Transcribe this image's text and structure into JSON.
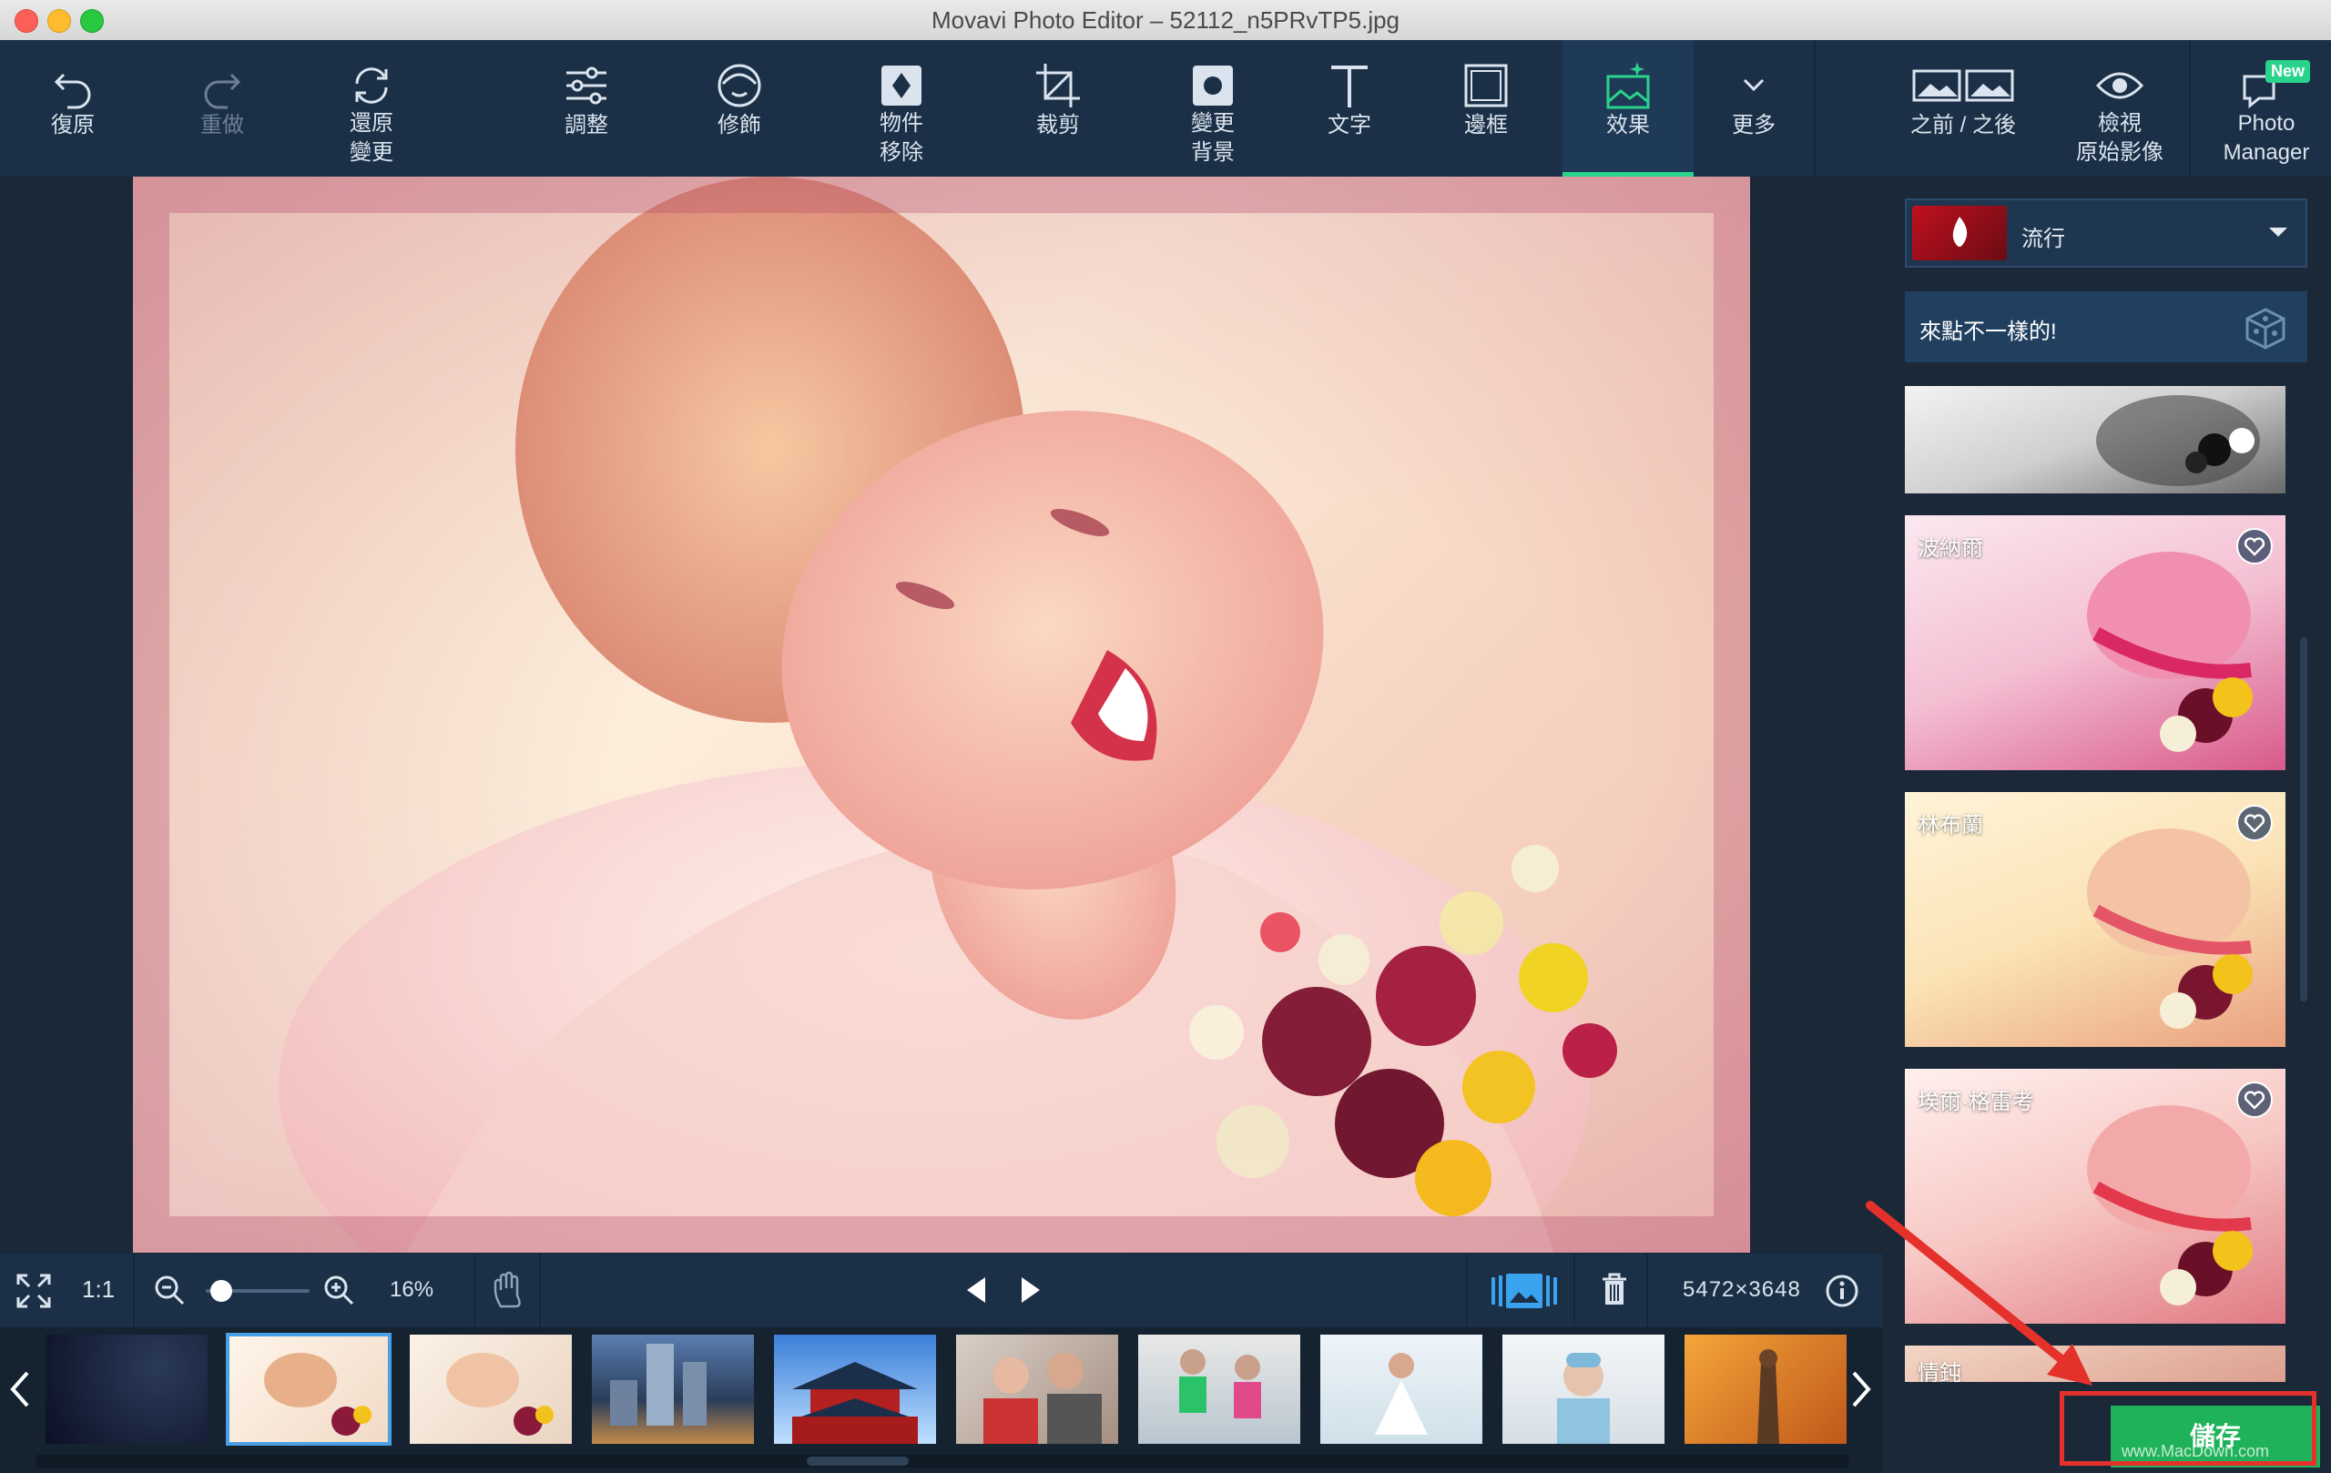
{
  "window": {
    "title": "Movavi Photo Editor – 52112_n5PRvTP5.jpg"
  },
  "toolbar": {
    "undo": "復原",
    "redo": "重做",
    "revert": "還原\n變更",
    "adjust": "調整",
    "retouch": "修飾",
    "object_removal": "物件\n移除",
    "crop": "裁剪",
    "change_background": "變更\n背景",
    "text": "文字",
    "frames": "邊框",
    "effects": "效果",
    "more": "更多",
    "before_after": "之前 / 之後",
    "view_original": "檢視\n原始影像",
    "photo_manager": "Photo\nManager",
    "new_badge": "New"
  },
  "effects_panel": {
    "category": "流行",
    "random_button": "來點不一樣的!",
    "effects": [
      {
        "name": ""
      },
      {
        "name": "波納爾"
      },
      {
        "name": "林布蘭"
      },
      {
        "name": "埃爾·格雷考"
      },
      {
        "name": "情鈍"
      }
    ]
  },
  "bottom_bar": {
    "ratio": "1:1",
    "zoom_percent": "16%",
    "zoom_level": 0.05,
    "dimensions": "5472×3648"
  },
  "save_button": "儲存",
  "watermark": "www.MacDown.com",
  "colors": {
    "accent_green": "#2ad38b",
    "save_green": "#1fb25a",
    "highlight_red": "#e5312b",
    "toolbar_bg": "#1b3047"
  }
}
